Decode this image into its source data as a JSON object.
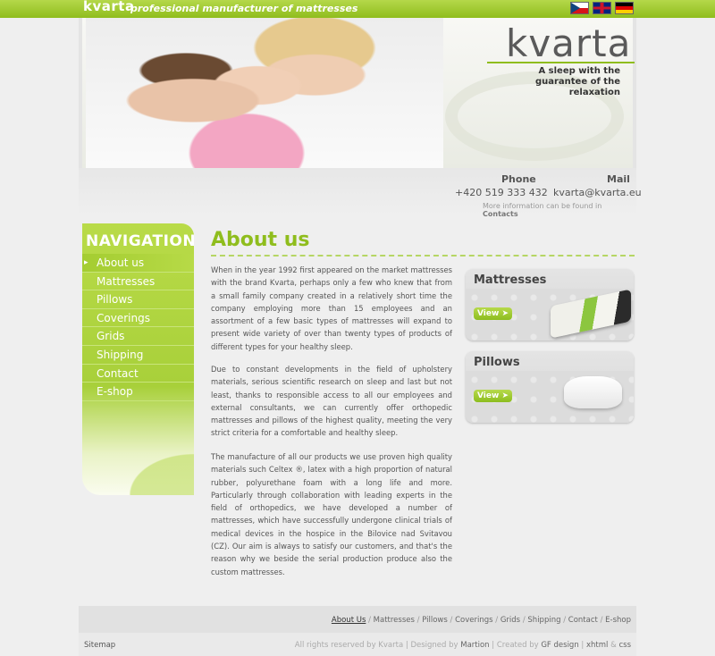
{
  "topbar": {
    "logo": "kvarta",
    "tagline": "professional manufacturer of mattresses",
    "languages": [
      "cz",
      "en",
      "de"
    ]
  },
  "hero": {
    "brand": "kvarta",
    "slogan": "A sleep with the guarantee of the relaxation"
  },
  "contact": {
    "phone_label": "Phone",
    "phone_value": "+420 519 333 432",
    "mail_label": "Mail",
    "mail_value": "kvarta@kvarta.eu",
    "more_text": "More information can be found in",
    "more_link": "Contacts"
  },
  "navigation": {
    "title": "NAVIGATION",
    "items": [
      {
        "label": "About us",
        "active": true
      },
      {
        "label": "Mattresses"
      },
      {
        "label": "Pillows"
      },
      {
        "label": "Coverings"
      },
      {
        "label": "Grids"
      },
      {
        "label": "Shipping"
      },
      {
        "label": "Contact"
      },
      {
        "label": "E-shop"
      }
    ]
  },
  "main": {
    "heading": "About us",
    "paragraphs": [
      "When in the year 1992 first appeared on the market mattresses with the brand Kvarta, perhaps only a few who knew that from a small family company created in a relatively short time the company employing more than 15 employees and an assortment of a few basic types of mattresses will expand to present wide variety of over than twenty types of products of different types for your healthy sleep.",
      "Due to constant developments in the field of upholstery materials, serious scientific research on sleep and last but not least, thanks to responsible access to all our employees and external consultants, we can currently offer orthopedic mattresses and pillows of the highest quality, meeting the very strict criteria for a comfortable and healthy sleep.",
      "The manufacture of all our products we use proven high quality materials such Celtex ®, latex with a high proportion of natural rubber, polyurethane foam with a long life and more. Particularly through collaboration with leading experts in the field of orthopedics, we have developed a number of mattresses, which have successfully undergone clinical trials of medical devices in the hospice in the Bilovice nad Svitavou (CZ). Our aim is always to satisfy our customers, and that's the reason why we beside the serial production produce also the custom mattresses."
    ]
  },
  "products": [
    {
      "title": "Mattresses",
      "button": "View ➤"
    },
    {
      "title": "Pillows",
      "button": "View ➤"
    }
  ],
  "footer": {
    "links": [
      "About Us",
      "Mattresses",
      "Pillows",
      "Coverings",
      "Grids",
      "Shipping",
      "Contact",
      "E-shop"
    ],
    "sitemap": "Sitemap",
    "rights": "All rights reserved by Kvarta",
    "designed_by_label": "Designed by",
    "designer": "Martion",
    "created_by_label": "Created by",
    "creator": "GF design",
    "tech1": "xhtml",
    "tech_sep": "&",
    "tech2": "css"
  }
}
